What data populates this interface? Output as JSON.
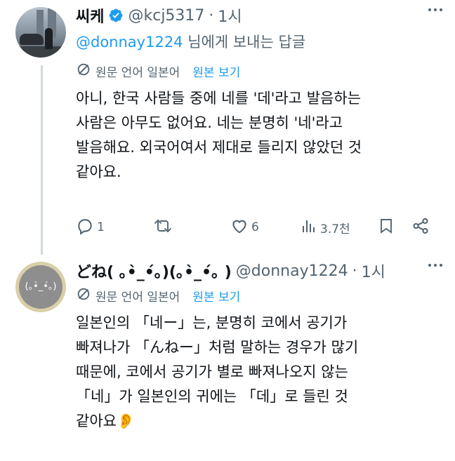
{
  "post1": {
    "name": "씨케",
    "handle": "@kcj5317",
    "time": "1시",
    "reply_prefix": "",
    "reply_mention": "@donnay1224",
    "reply_suffix": " 님에게 보내는 답글",
    "translate_label": "원문 언어 일본어",
    "translate_link": "원본 보기",
    "body": "아니, 한국 사람들 중에 네를 '데'라고 발음하는\n사람은 아무도 없어요. 네는 분명히 '네'라고\n발음해요. 외국어여서 제대로 들리지 않았던 것\n같아요.",
    "actions": {
      "replies": "1",
      "retweets": "",
      "likes": "6",
      "views": "3.7천"
    }
  },
  "post2": {
    "name": "どね( ｡•̀_•́｡)(｡•̀_•́｡ )",
    "handle": "@donnay1224",
    "time": "1시",
    "avatar_text": "(｡•̀_•́｡)",
    "translate_label": "원문 언어 일본어",
    "translate_link": "원본 보기",
    "body": "일본인의 「네ー」는, 분명히 코에서 공기가\n빠져나가 「んねー」처럼 말하는 경우가 많기\n때문에, 코에서 공기가 별로 빠져나오지 않는\n「네」가 일본인의 귀에는 「데」로 들린 것\n같아요👂"
  },
  "colors": {
    "link": "#1d9bf0",
    "muted": "#536471",
    "verified": "#1d9bf0",
    "thread_line": "#cfd9de"
  },
  "icons": [
    "verified-badge-icon",
    "more-icon",
    "translate-icon",
    "reply-icon",
    "retweet-icon",
    "like-icon",
    "views-icon",
    "bookmark-icon",
    "share-icon"
  ]
}
